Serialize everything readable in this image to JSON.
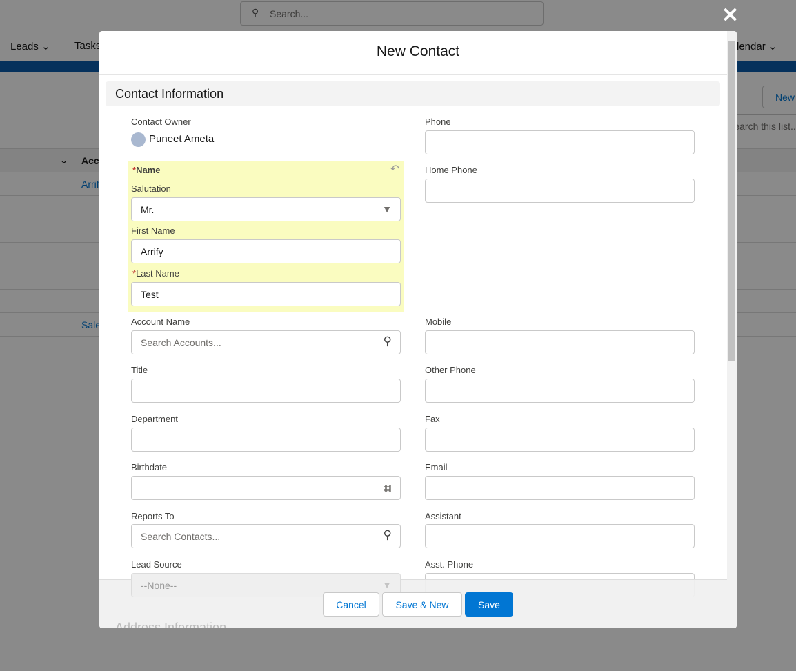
{
  "background": {
    "search_placeholder": "Search...",
    "nav": [
      "Leads",
      "Tasks",
      "lendar"
    ],
    "new_button": "New",
    "list_search_placeholder": "Search this list...",
    "table_header": "Acc",
    "rows": [
      "Arrif",
      "",
      "",
      "",
      "",
      "",
      "Sale"
    ]
  },
  "modal": {
    "title": "New Contact",
    "section": "Contact Information",
    "next_section": "Address Information",
    "left": {
      "owner_label": "Contact Owner",
      "owner_name": "Puneet Ameta",
      "name_label": "Name",
      "salutation_label": "Salutation",
      "salutation_value": "Mr.",
      "first_name_label": "First Name",
      "first_name_value": "Arrify",
      "last_name_label": "Last Name",
      "last_name_value": "Test",
      "account_label": "Account Name",
      "account_placeholder": "Search Accounts...",
      "title_label": "Title",
      "department_label": "Department",
      "birthdate_label": "Birthdate",
      "reports_label": "Reports To",
      "reports_placeholder": "Search Contacts...",
      "lead_source_label": "Lead Source",
      "lead_source_value": "--None--"
    },
    "right": {
      "phone": "Phone",
      "home_phone": "Home Phone",
      "mobile": "Mobile",
      "other_phone": "Other Phone",
      "fax": "Fax",
      "email": "Email",
      "assistant": "Assistant",
      "asst_phone": "Asst. Phone"
    },
    "buttons": {
      "cancel": "Cancel",
      "save_new": "Save & New",
      "save": "Save"
    }
  },
  "colors": {
    "brand": "#0176d3",
    "name_highlight": "#fafcc0"
  }
}
